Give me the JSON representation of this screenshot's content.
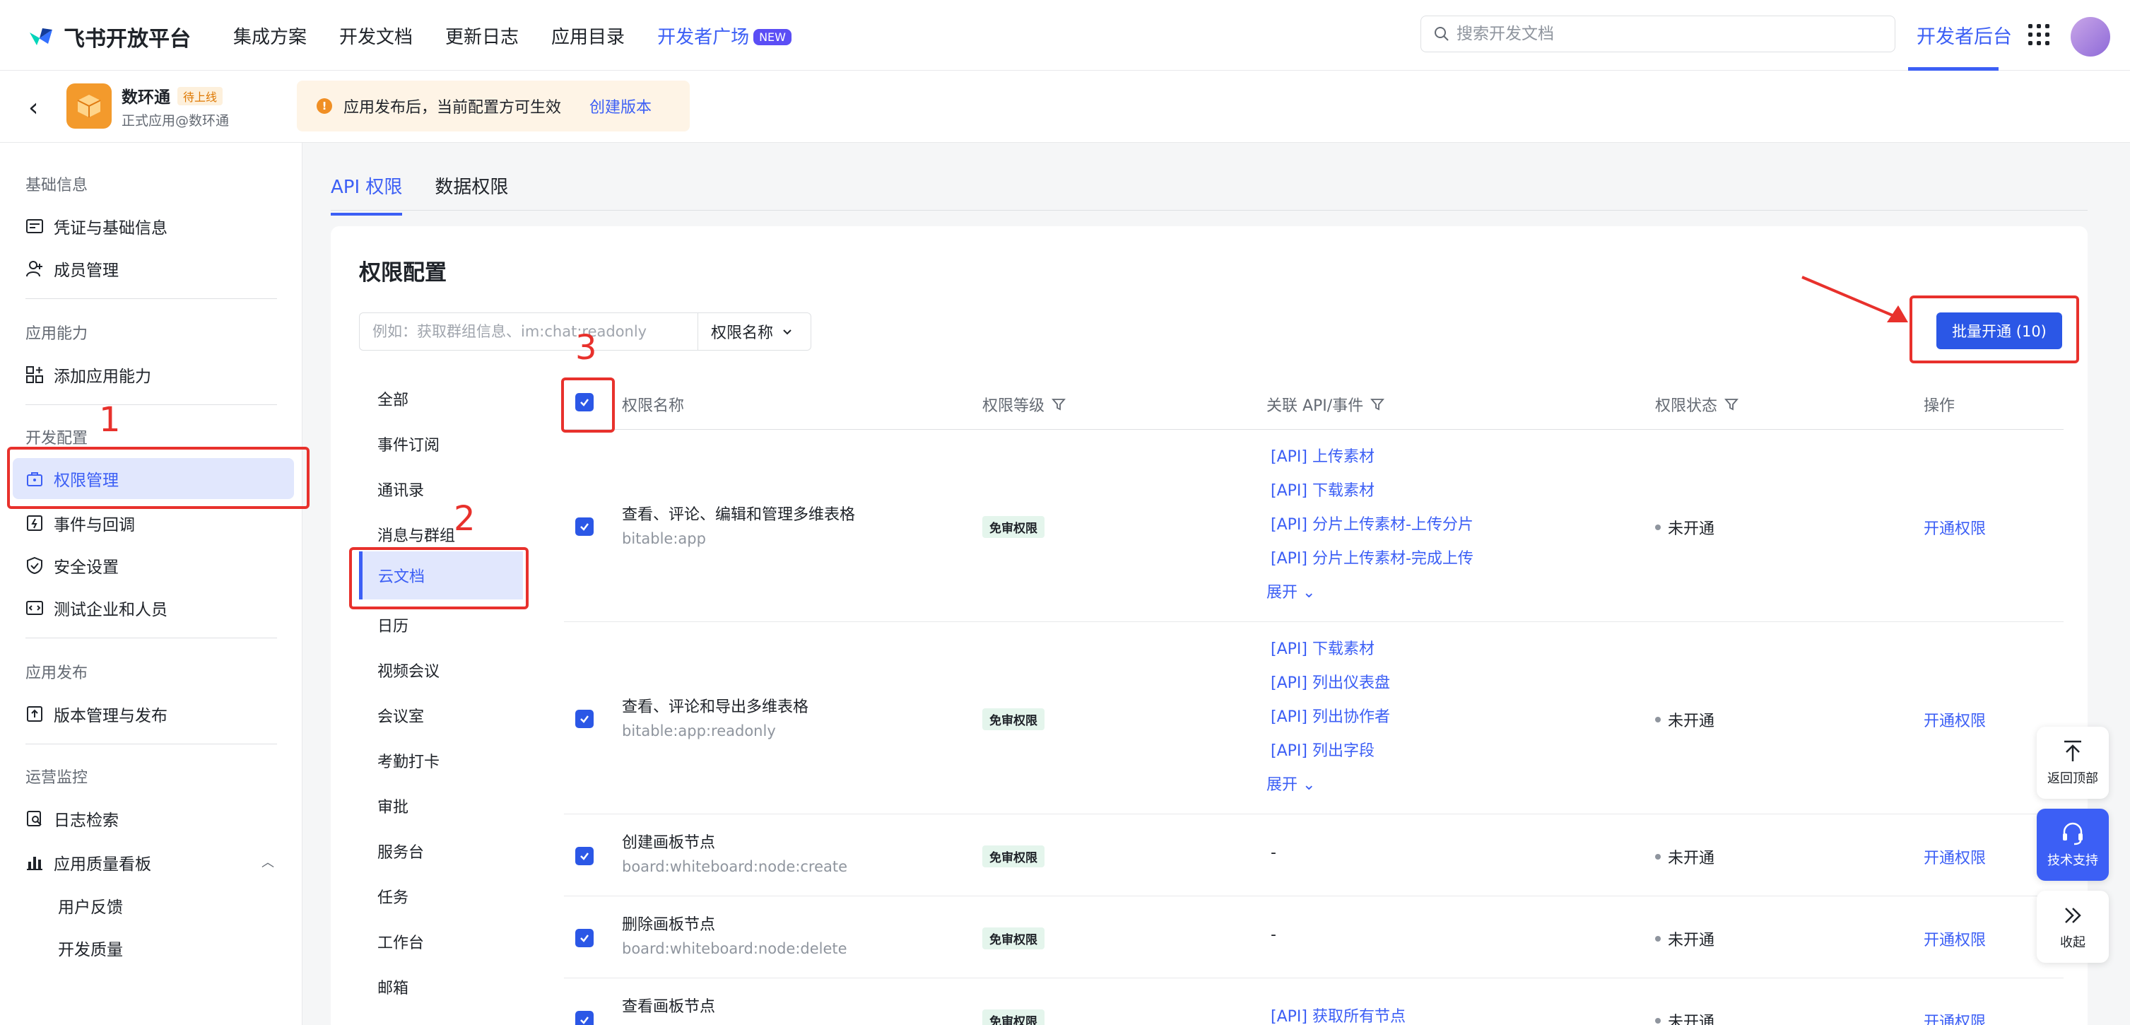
{
  "topbar": {
    "logo": "飞书开放平台",
    "nav": [
      "集成方案",
      "开发文档",
      "更新日志",
      "应用目录",
      "开发者广场"
    ],
    "nav_badge": "NEW",
    "search_placeholder": "搜索开发文档",
    "dev_console": "开发者后台"
  },
  "appbar": {
    "app_name": "数环通",
    "app_status": "待上线",
    "app_sub": "正式应用@数环通",
    "notice": "应用发布后，当前配置方可生效",
    "notice_link": "创建版本"
  },
  "sidebar": {
    "sec_basic": "基础信息",
    "credentials": "凭证与基础信息",
    "members": "成员管理",
    "sec_ability": "应用能力",
    "add_ability": "添加应用能力",
    "sec_dev": "开发配置",
    "permission": "权限管理",
    "events": "事件与回调",
    "security": "安全设置",
    "test_org": "测试企业和人员",
    "sec_release": "应用发布",
    "version": "版本管理与发布",
    "sec_ops": "运营监控",
    "logs": "日志检索",
    "quality": "应用质量看板",
    "feedback": "用户反馈",
    "dev_quality": "开发质量"
  },
  "tabs": [
    "API 权限",
    "数据权限"
  ],
  "card": {
    "title": "权限配置",
    "filter_placeholder": "例如：获取群组信息、im:chat:readonly",
    "filter_select": "权限名称",
    "batch_button": "批量开通 (10)"
  },
  "categories": [
    "全部",
    "事件订阅",
    "通讯录",
    "消息与群组",
    "云文档",
    "日历",
    "视频会议",
    "会议室",
    "考勤打卡",
    "审批",
    "服务台",
    "任务",
    "工作台",
    "邮箱"
  ],
  "table": {
    "headers": {
      "name": "权限名称",
      "level": "权限等级",
      "api": "关联 API/事件",
      "status": "权限状态",
      "op": "操作"
    },
    "rows": [
      {
        "name": "查看、评论、编辑和管理多维表格",
        "code": "bitable:app",
        "level": "免审权限",
        "apis": [
          "[API] 上传素材",
          "[API] 下载素材",
          "[API] 分片上传素材-上传分片",
          "[API] 分片上传素材-完成上传"
        ],
        "expand": "展开",
        "status": "未开通",
        "op": "开通权限"
      },
      {
        "name": "查看、评论和导出多维表格",
        "code": "bitable:app:readonly",
        "level": "免审权限",
        "apis": [
          "[API] 下载素材",
          "[API] 列出仪表盘",
          "[API] 列出协作者",
          "[API] 列出字段"
        ],
        "expand": "展开",
        "status": "未开通",
        "op": "开通权限"
      },
      {
        "name": "创建画板节点",
        "code": "board:whiteboard:node:create",
        "level": "免审权限",
        "api_text": "-",
        "status": "未开通",
        "op": "开通权限"
      },
      {
        "name": "删除画板节点",
        "code": "board:whiteboard:node:delete",
        "level": "免审权限",
        "api_text": "-",
        "status": "未开通",
        "op": "开通权限"
      },
      {
        "name": "查看画板节点",
        "level": "免审权限",
        "api_text": "[API] 获取所有节点",
        "status": "未开通",
        "op": "开通权限"
      }
    ]
  },
  "annotations": [
    "1",
    "2",
    "3"
  ],
  "float_toolbar": {
    "top": "返回顶部",
    "support": "技术支持",
    "collapse": "收起"
  },
  "colors": {
    "accent": "#3c5ff5",
    "annotation": "#e8312c",
    "app_icon": "#f39a2c"
  }
}
